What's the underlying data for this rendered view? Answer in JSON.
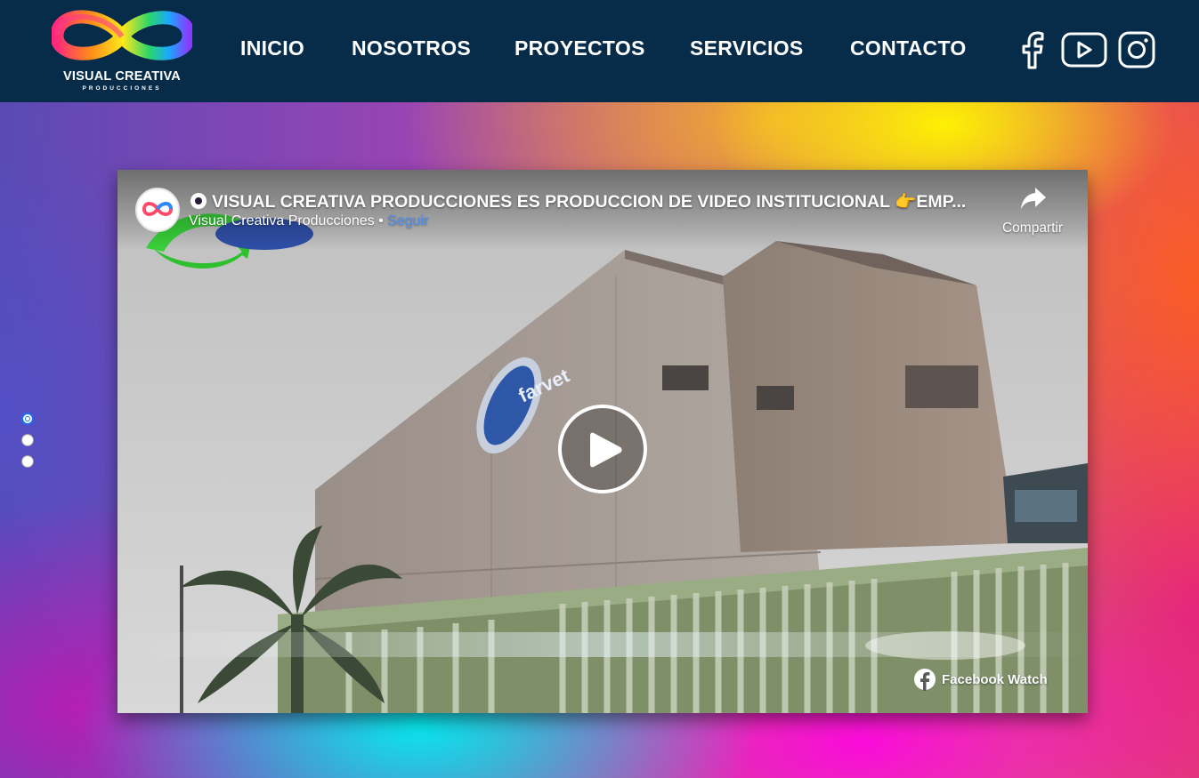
{
  "brand": {
    "name": "VISUAL CREATIVA",
    "tagline": "PRODUCCIONES"
  },
  "nav": {
    "items": [
      {
        "label": "INICIO"
      },
      {
        "label": "NOSOTROS"
      },
      {
        "label": "PROYECTOS"
      },
      {
        "label": "SERVICIOS"
      },
      {
        "label": "CONTACTO"
      }
    ]
  },
  "social": {
    "icons": [
      "facebook-icon",
      "youtube-icon",
      "instagram-icon"
    ]
  },
  "carousel": {
    "slide_count": 3,
    "active_index": 0
  },
  "video": {
    "title": "VISUAL CREATIVA PRODUCCIONES ES PRODUCCION DE VIDEO INSTITUCIONAL 👉EMP...",
    "channel": "Visual Creativa Producciones",
    "separator": " • ",
    "follow_label": "Seguir",
    "share_label": "Compartir",
    "watch_label": "Facebook Watch",
    "scene_sign_text": "farvet"
  },
  "colors": {
    "header_bg": "#062c4a",
    "active_dot": "#1a6ff0",
    "follow_link": "#4a8ff5"
  }
}
